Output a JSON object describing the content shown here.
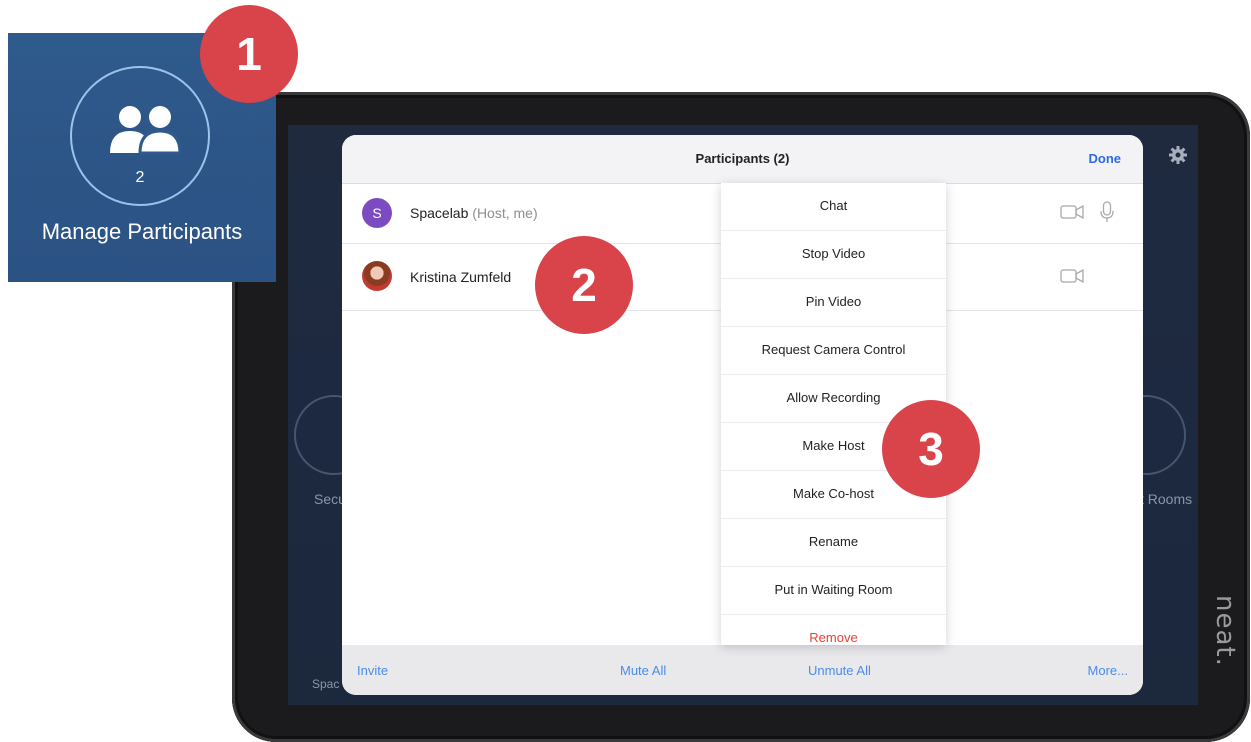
{
  "tile": {
    "participant_count": "2",
    "label": "Manage Participants"
  },
  "background": {
    "left_label": "Secu",
    "right_label": "t Rooms",
    "bottom_label": "Spac"
  },
  "device": {
    "brand": "neat."
  },
  "dialog": {
    "title": "Participants (2)",
    "done_label": "Done",
    "participants": [
      {
        "initial": "S",
        "name": "Spacelab",
        "role": "(Host, me)"
      },
      {
        "name": "Kristina Zumfeld"
      }
    ],
    "footer": {
      "invite": "Invite",
      "mute_all": "Mute All",
      "unmute_all": "Unmute All",
      "more": "More..."
    }
  },
  "menu": {
    "items": [
      "Chat",
      "Stop Video",
      "Pin Video",
      "Request Camera Control",
      "Allow Recording",
      "Make Host",
      "Make Co-host",
      "Rename",
      "Put in Waiting Room",
      "Remove"
    ]
  },
  "badges": [
    "1",
    "2",
    "3"
  ],
  "colors": {
    "tile_bg": "#2f5a8c",
    "badge": "#d9434a",
    "link": "#4a8ce6",
    "danger": "#e5403a",
    "host_avatar": "#7c4bc1"
  }
}
